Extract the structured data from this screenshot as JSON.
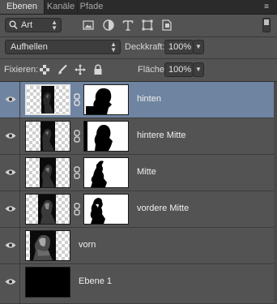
{
  "tabs": [
    {
      "label": "Ebenen",
      "active": true
    },
    {
      "label": "Kanäle",
      "active": false
    },
    {
      "label": "Pfade",
      "active": false
    }
  ],
  "filter": {
    "kind_label": "Art",
    "icons": [
      "image-filter-icon",
      "adjustment-filter-icon",
      "type-filter-icon",
      "shape-filter-icon",
      "smartobject-filter-icon"
    ]
  },
  "blend": {
    "mode": "Aufhellen",
    "opacity_label": "Deckkraft:",
    "opacity_value": "100%"
  },
  "lock": {
    "label": "Fixieren:",
    "fill_label": "Fläche:",
    "fill_value": "100%"
  },
  "layers": [
    {
      "name": "hinten",
      "selected": true,
      "has_mask": true,
      "thumb": "hinten-thumb",
      "mask": "hinten-mask"
    },
    {
      "name": "hintere Mitte",
      "selected": false,
      "has_mask": true,
      "thumb": "hintere-mitte-thumb",
      "mask": "hintere-mitte-mask"
    },
    {
      "name": "Mitte",
      "selected": false,
      "has_mask": true,
      "thumb": "mitte-thumb",
      "mask": "mitte-mask"
    },
    {
      "name": "vordere Mitte",
      "selected": false,
      "has_mask": true,
      "thumb": "vordere-mitte-thumb",
      "mask": "vordere-mitte-mask"
    },
    {
      "name": "vorn",
      "selected": false,
      "has_mask": false,
      "thumb": "vorn-thumb"
    },
    {
      "name": "Ebene 1",
      "selected": false,
      "has_mask": false,
      "thumb": "black-fill-thumb"
    }
  ],
  "colors": {
    "panel_bg": "#535353",
    "selected_row": "#6f84a0",
    "tab_bar": "#2b2b2b"
  }
}
